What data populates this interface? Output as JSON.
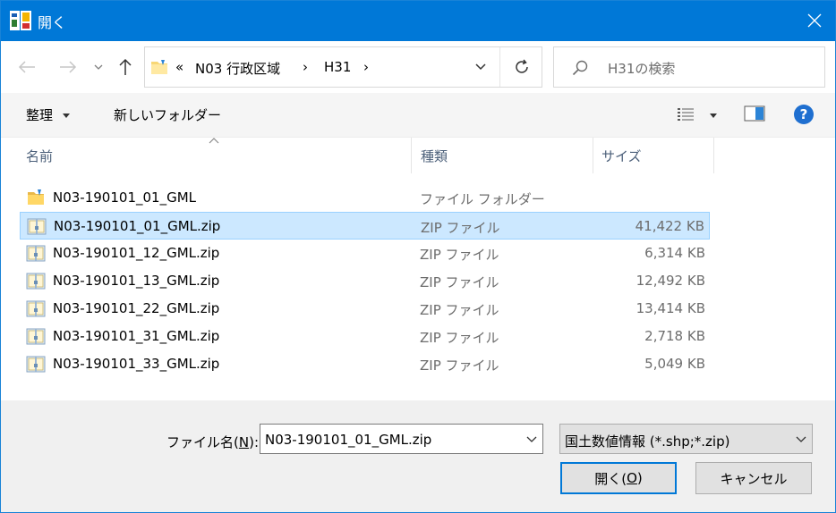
{
  "window": {
    "title": "開く",
    "accent": "#0078d7"
  },
  "nav": {
    "back_icon": "arrow-left-icon",
    "forward_icon": "arrow-right-icon",
    "recent_icon": "chevron-down-icon",
    "up_icon": "arrow-up-icon"
  },
  "address": {
    "overflow": "«",
    "segments": [
      "N03 行政区域",
      "H31"
    ],
    "separator": "›"
  },
  "search": {
    "placeholder": "H31の検索"
  },
  "toolbar": {
    "organize_label": "整理",
    "new_folder_label": "新しいフォルダー"
  },
  "columns": {
    "name": "名前",
    "type": "種類",
    "size": "サイズ"
  },
  "files": [
    {
      "name": "N03-190101_01_GML",
      "type": "ファイル フォルダー",
      "size": "",
      "kind": "folder"
    },
    {
      "name": "N03-190101_01_GML.zip",
      "type": "ZIP ファイル",
      "size": "41,422 KB",
      "kind": "zip",
      "selected": true
    },
    {
      "name": "N03-190101_12_GML.zip",
      "type": "ZIP ファイル",
      "size": "6,314 KB",
      "kind": "zip"
    },
    {
      "name": "N03-190101_13_GML.zip",
      "type": "ZIP ファイル",
      "size": "12,492 KB",
      "kind": "zip"
    },
    {
      "name": "N03-190101_22_GML.zip",
      "type": "ZIP ファイル",
      "size": "13,414 KB",
      "kind": "zip"
    },
    {
      "name": "N03-190101_31_GML.zip",
      "type": "ZIP ファイル",
      "size": "2,718 KB",
      "kind": "zip"
    },
    {
      "name": "N03-190101_33_GML.zip",
      "type": "ZIP ファイル",
      "size": "5,049 KB",
      "kind": "zip"
    }
  ],
  "footer": {
    "filename_label_pre": "ファイル名(",
    "filename_label_key": "N",
    "filename_label_post": "):",
    "filename_value": "N03-190101_01_GML.zip",
    "filter_value": "国土数値情報 (*.shp;*.zip)",
    "open_label_pre": "開く(",
    "open_label_key": "O",
    "open_label_post": ")",
    "cancel_label": "キャンセル"
  }
}
